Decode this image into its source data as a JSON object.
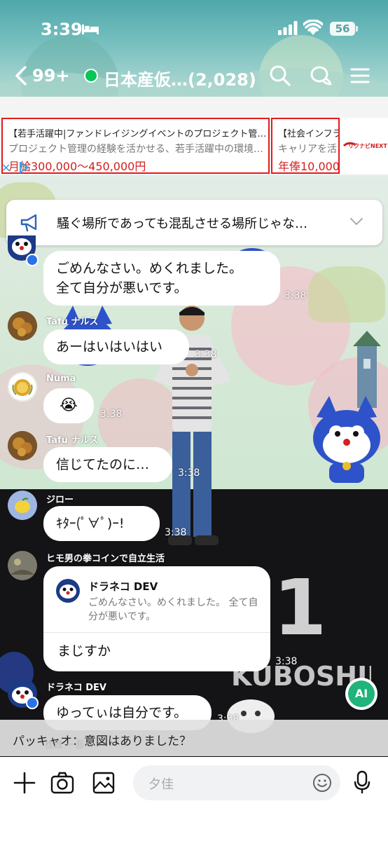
{
  "status_bar": {
    "time": "3:39",
    "battery": "56"
  },
  "header": {
    "unread_count": "99+",
    "chat_title": "日本産仮…(2,028)"
  },
  "ad": {
    "card1": {
      "title": "【若手活躍中|ファンドレイジングイベントのプロジェクト管…",
      "desc": "プロジェクト管理の経験を活かせる、若手活躍中の環境…",
      "salary": "月給300,000〜450,000円"
    },
    "card2": {
      "title": "【社会インフラ",
      "desc": "キャリアを活",
      "salary": "年俸10,000"
    },
    "logo_text": "リクナビNEXT"
  },
  "announcement": {
    "text": "騒ぐ場所であっても混乱させる場所じゃな…"
  },
  "messages": [
    {
      "text": "ごめんなさい。めくれました。\n全て自分が悪いです。",
      "time": "3:38"
    },
    {
      "sender": "Tafu ナルス",
      "text": "あーはいはいはい",
      "time": "3:38"
    },
    {
      "sender": "Numa",
      "text": "😭",
      "time": "3:38"
    },
    {
      "sender": "Tafu ナルス",
      "text": "信じてたのに…",
      "time": "3:38"
    },
    {
      "sender": "ジロー",
      "text": "ｷﾀｰ(ﾟ∀ﾟ)ｰ!",
      "time": "3:38"
    },
    {
      "sender": "ヒモ男の拳コインで自立生活",
      "reply_name": "ドラネコ DEV",
      "reply_quote": "ごめんなさい。めくれました。 全て自分が悪いです。",
      "text": "まじすか",
      "time": "3:38"
    },
    {
      "sender": "ドラネコ DEV",
      "text": "ゆってぃは自分です。",
      "time": "3:38"
    }
  ],
  "background_text": {
    "big_number": "1",
    "banner": "KUBOSHIDE"
  },
  "ai_button": {
    "label": "AI"
  },
  "preview": {
    "text": "パッキャオ：意図はありました？",
    "under": "枕既 一吾"
  },
  "input": {
    "placeholder": "夕佳"
  }
}
